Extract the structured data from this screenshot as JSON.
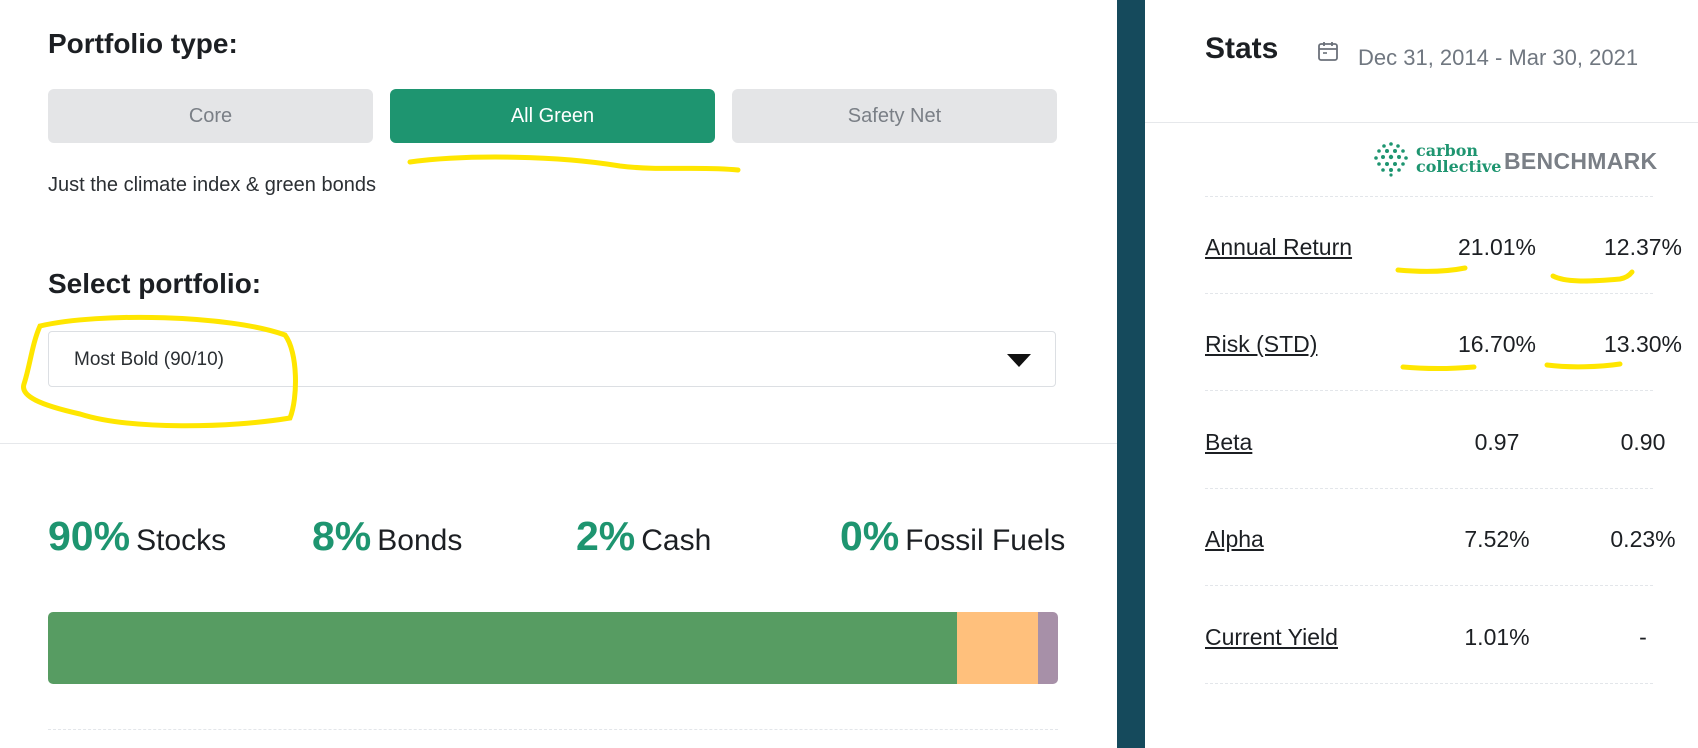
{
  "portfolio_type": {
    "title": "Portfolio type:",
    "options": [
      "Core",
      "All Green",
      "Safety Net"
    ],
    "selected": "All Green",
    "description": "Just the climate index & green bonds"
  },
  "select_portfolio": {
    "title": "Select portfolio:",
    "value": "Most Bold (90/10)"
  },
  "allocation": {
    "items": [
      {
        "pct": "90%",
        "label": "Stocks",
        "value": 90,
        "color": "#579c62"
      },
      {
        "pct": "8%",
        "label": "Bonds",
        "value": 8,
        "color": "#ffc07c"
      },
      {
        "pct": "2%",
        "label": "Cash",
        "value": 2,
        "color": "#a790a8"
      },
      {
        "pct": "0%",
        "label": "Fossil Fuels",
        "value": 0,
        "color": "#000000"
      }
    ]
  },
  "stats": {
    "title": "Stats",
    "date_range": "Dec 31, 2014 - Mar 30, 2021",
    "logo_text_line1": "carbon",
    "logo_text_line2": "collective",
    "benchmark_label": "BENCHMARK",
    "rows": [
      {
        "label": "Annual Return",
        "carbon": "21.01%",
        "benchmark": "12.37%"
      },
      {
        "label": "Risk (STD)",
        "carbon": "16.70%",
        "benchmark": "13.30%"
      },
      {
        "label": "Beta",
        "carbon": "0.97",
        "benchmark": "0.90"
      },
      {
        "label": "Alpha",
        "carbon": "7.52%",
        "benchmark": "0.23%"
      },
      {
        "label": "Current Yield",
        "carbon": "1.01%",
        "benchmark": "-"
      }
    ]
  },
  "colors": {
    "accent": "#1e9570",
    "divider": "#154a5c",
    "highlight": "#ffe600"
  }
}
